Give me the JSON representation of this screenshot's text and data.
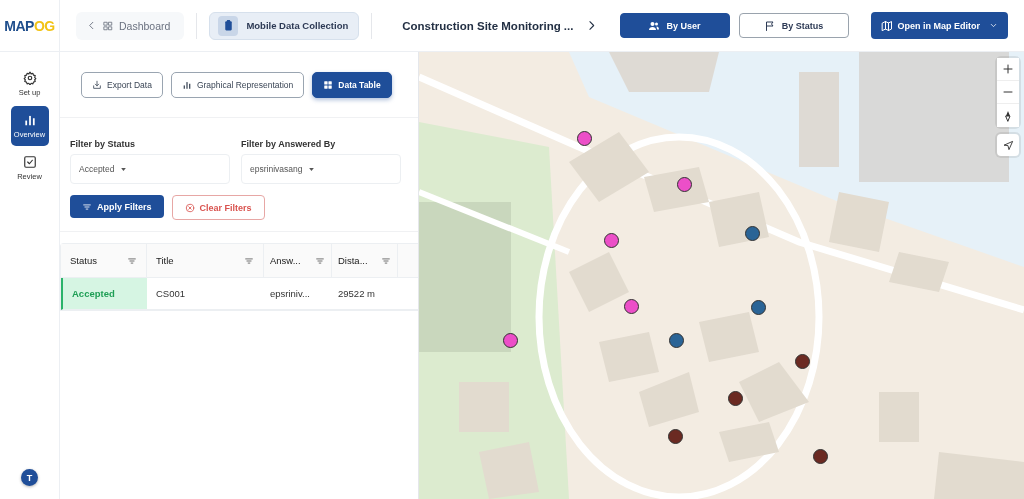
{
  "header": {
    "logo": {
      "primary": "MAP",
      "accent": "OG"
    },
    "back": {
      "label": "Dashboard"
    },
    "module": {
      "label": "Mobile Data Collection",
      "selected": true
    },
    "title": "Construction Site Monitoring ...",
    "views": [
      {
        "label": "By User",
        "kind": "user",
        "selected": true
      },
      {
        "label": "By Status",
        "kind": "status",
        "selected": false
      }
    ],
    "editor_button": {
      "label": "Open in Map Editor"
    }
  },
  "sidebar": {
    "items": [
      {
        "label": "Set up",
        "kind": "settings",
        "selected": false
      },
      {
        "label": "Overview",
        "kind": "chart",
        "selected": true
      },
      {
        "label": "Review",
        "kind": "review",
        "selected": false
      }
    ],
    "avatar": "T"
  },
  "panel": {
    "tabs": [
      {
        "label": "Export Data",
        "kind": "export",
        "selected": false
      },
      {
        "label": "Graphical Representation",
        "kind": "chart",
        "selected": false
      },
      {
        "label": "Data Table",
        "kind": "table",
        "selected": true
      }
    ],
    "filters": [
      {
        "label": "Filter by Status",
        "value": "Accepted"
      },
      {
        "label": "Filter by Answered By",
        "value": "epsrinivasang"
      }
    ],
    "apply_button": "Apply Filters",
    "clear_button": "Clear Filters",
    "table": {
      "columns": [
        "Status",
        "Title",
        "Answ...",
        "Dista..."
      ],
      "rows": [
        {
          "status": "Accepted",
          "kind": "accepted",
          "title": "CS001",
          "answered_by": "epsriniv...",
          "distance": "29522 m"
        }
      ]
    }
  },
  "map": {
    "markers": [
      {
        "color": "#ec4fc8"
      },
      {
        "color": "#ec4fc8"
      },
      {
        "color": "#ec4fc8"
      },
      {
        "color": "#ec4fc8"
      },
      {
        "color": "#ec4fc8"
      },
      {
        "color": "#2a6496"
      },
      {
        "color": "#2a6496"
      },
      {
        "color": "#2a6496"
      },
      {
        "color": "#6b2a22"
      },
      {
        "color": "#6b2a22"
      },
      {
        "color": "#6b2a22"
      },
      {
        "color": "#6b2a22"
      }
    ]
  }
}
